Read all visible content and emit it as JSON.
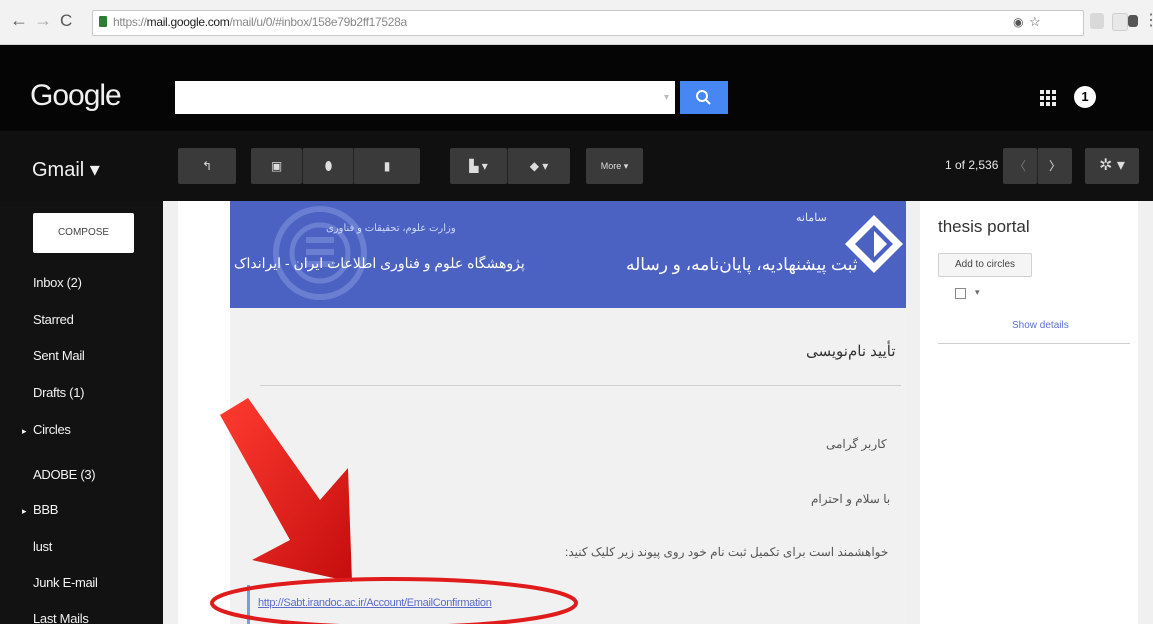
{
  "browser": {
    "url_prefix": "https://",
    "url_host": "mail.google.com",
    "url_path": "/mail/u/0/#inbox/158e79b2ff17528a"
  },
  "header": {
    "logo": "Google",
    "search_placeholder": "",
    "notification_count": "1"
  },
  "toolbar": {
    "gmail_label": "Gmail ▾",
    "more_label": "More ▾",
    "pager_text": "1 of 2,536"
  },
  "sidebar": {
    "compose_label": "COMPOSE",
    "items": [
      {
        "label": "Inbox (2)"
      },
      {
        "label": "Starred"
      },
      {
        "label": "Sent Mail"
      },
      {
        "label": "Drafts (1)"
      },
      {
        "label": "Circles"
      },
      {
        "label": "ADOBE (3)"
      },
      {
        "label": "BBB"
      },
      {
        "label": "lust"
      },
      {
        "label": "Junk E-mail"
      },
      {
        "label": "Last Mails"
      }
    ]
  },
  "email": {
    "banner_small": "سامانه",
    "banner_title": "ثبت پیشنهادیه، پایان‌نامه، و رساله",
    "org_small": "وزارت علوم، تحقیقات و فناوری",
    "org_title": "پژوهشگاه علوم و فناوری اطلاعات ایران - ایرانداک",
    "heading": "تأیید نام‌نویسی",
    "greeting": "کاربر گرامی",
    "salutation": "با سلام و احترام",
    "instruction": "خواهشمند است برای تکمیل ثبت نام خود روی پیوند زیر کلیک کنید:",
    "link": "http://Sabt.irandoc.ac.ir/Account/EmailConfirmation"
  },
  "contact_panel": {
    "sender": "thesis portal",
    "add_to_circles": "Add to circles",
    "show_details": "Show details"
  },
  "colors": {
    "search_button": "#4687f4",
    "banner": "#4b62c2",
    "arrow": "#e01b1b"
  },
  "icons": [
    "back-icon",
    "forward-icon",
    "reload-icon",
    "lock-icon",
    "search-icon",
    "apps-icon",
    "reply-icon",
    "archive-icon",
    "spam-icon",
    "delete-icon",
    "move-to-icon",
    "labels-icon",
    "settings-icon",
    "chevron-left-icon",
    "chevron-right-icon"
  ]
}
